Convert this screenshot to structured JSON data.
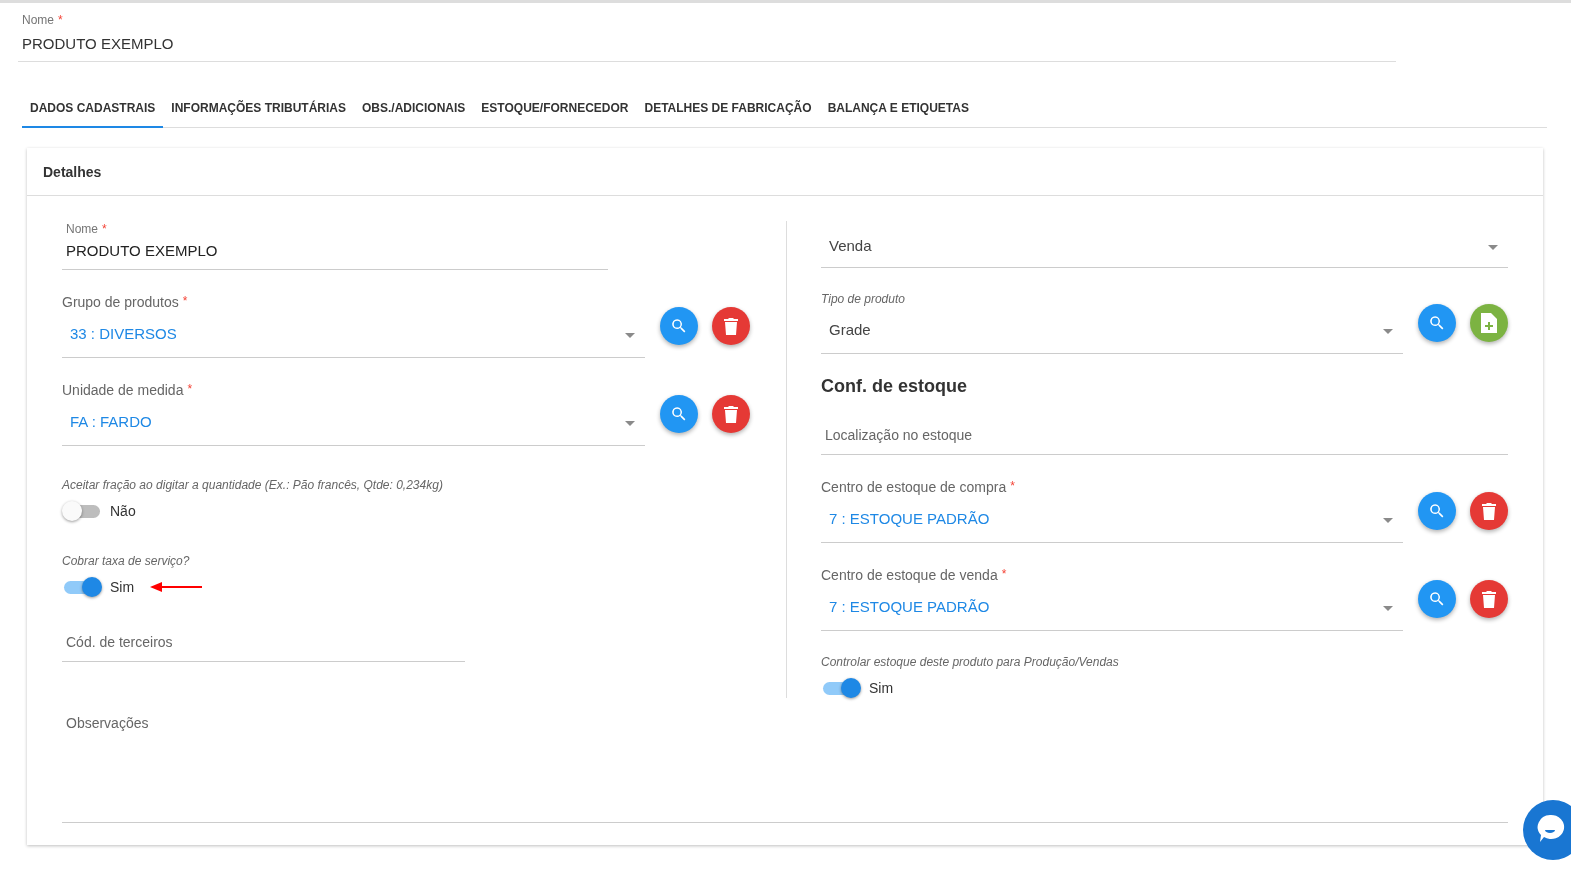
{
  "header_field": {
    "label": "Nome",
    "required_mark": "*",
    "value": "PRODUTO EXEMPLO"
  },
  "tabs": [
    {
      "label": "DADOS CADASTRAIS",
      "selected": true
    },
    {
      "label": "INFORMAÇÕES TRIBUTÁRIAS",
      "selected": false
    },
    {
      "label": "OBS./ADICIONAIS",
      "selected": false
    },
    {
      "label": "ESTOQUE/FORNECEDOR",
      "selected": false
    },
    {
      "label": "DETALHES DE FABRICAÇÃO",
      "selected": false
    },
    {
      "label": "BALANÇA E ETIQUETAS",
      "selected": false
    }
  ],
  "panel": {
    "title": "Detalhes",
    "left_column": [
      {
        "kind": "input",
        "label": "Nome",
        "required_mark": "*",
        "value": "PRODUTO EXEMPLO"
      },
      {
        "kind": "select",
        "label": "Grupo de produtos",
        "required_mark": "*",
        "value": "33 : DIVERSOS",
        "linked": true,
        "buttons": [
          {
            "kind": "search"
          },
          {
            "kind": "delete"
          }
        ]
      },
      {
        "kind": "select",
        "label": "Unidade de medida",
        "required_mark": "*",
        "value": "FA : FARDO",
        "linked": true,
        "buttons": [
          {
            "kind": "search"
          },
          {
            "kind": "delete"
          }
        ]
      },
      {
        "kind": "toggle",
        "label": "Aceitar fração ao digitar a quantidade (Ex.: Pão francês, Qtde: 0,234kg)",
        "on": false,
        "state_text": "Não"
      },
      {
        "kind": "toggle",
        "label": "Cobrar taxa de serviço?",
        "on": true,
        "state_text": "Sim",
        "pointer_arrow": true
      },
      {
        "kind": "placeholder-input",
        "placeholder": "Cód. de terceiros"
      }
    ],
    "right_column": [
      {
        "kind": "select",
        "value": "Venda",
        "linked": false
      },
      {
        "kind": "select",
        "label": "Tipo de produto",
        "caption_label": true,
        "value": "Grade",
        "linked": false,
        "buttons": [
          {
            "kind": "search"
          },
          {
            "kind": "add-file"
          }
        ]
      },
      {
        "kind": "heading",
        "text": "Conf. de estoque"
      },
      {
        "kind": "placeholder-input",
        "placeholder": "Localização no estoque"
      },
      {
        "kind": "select",
        "label": "Centro de estoque de compra",
        "required_mark": "*",
        "value": "7 : ESTOQUE PADRÃO",
        "linked": true,
        "buttons": [
          {
            "kind": "search"
          },
          {
            "kind": "delete"
          }
        ]
      },
      {
        "kind": "select",
        "label": "Centro de estoque de venda",
        "required_mark": "*",
        "value": "7 : ESTOQUE PADRÃO",
        "linked": true,
        "buttons": [
          {
            "kind": "search"
          },
          {
            "kind": "delete"
          }
        ]
      },
      {
        "kind": "toggle",
        "label": "Controlar estoque deste produto para Produção/Vendas",
        "on": true,
        "state_text": "Sim"
      }
    ],
    "notes_field": {
      "placeholder": "Observações"
    }
  }
}
